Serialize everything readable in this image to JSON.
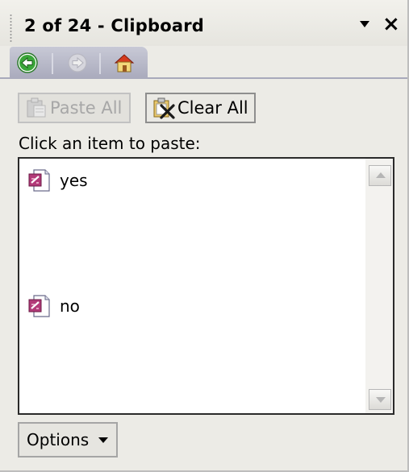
{
  "pane": {
    "title": "2 of 24 - Clipboard"
  },
  "toolbar": {
    "paste_all_label": "Paste All",
    "clear_all_label": "Clear All"
  },
  "instruction": "Click an item to paste:",
  "clipboard_items": [
    {
      "label": "yes",
      "icon": "office-doc-icon"
    },
    {
      "label": "no",
      "icon": "office-doc-icon"
    }
  ],
  "footer": {
    "options_label": "Options"
  },
  "colors": {
    "pane_bg": "#ecebe6",
    "nav_bar": "#b9bacb",
    "back_icon": "#2a9d2a"
  }
}
